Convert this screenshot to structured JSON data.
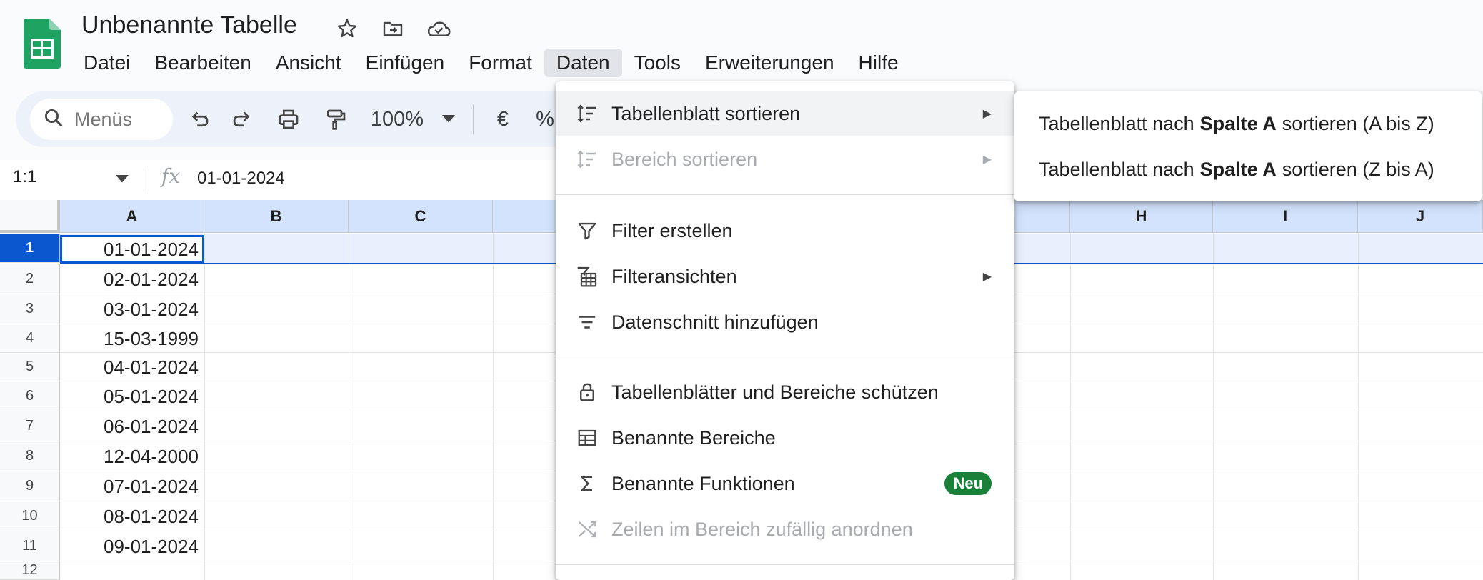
{
  "app": {
    "title": "Unbenannte Tabelle",
    "accent": "#0b57d0",
    "brand": "#188038"
  },
  "menubar": [
    {
      "label": "Datei"
    },
    {
      "label": "Bearbeiten"
    },
    {
      "label": "Ansicht"
    },
    {
      "label": "Einfügen"
    },
    {
      "label": "Format"
    },
    {
      "label": "Daten",
      "active": true
    },
    {
      "label": "Tools"
    },
    {
      "label": "Erweiterungen"
    },
    {
      "label": "Hilfe"
    }
  ],
  "toolbar": {
    "search_placeholder": "Menüs",
    "zoom": "100%",
    "currency": "€",
    "percent": "%"
  },
  "formula_bar": {
    "cell_ref": "1:1",
    "fx": "fx",
    "value": "01-01-2024"
  },
  "grid": {
    "columns": [
      "A",
      "B",
      "C",
      "H",
      "I",
      "J"
    ],
    "rows": [
      "1",
      "2",
      "3",
      "4",
      "5",
      "6",
      "7",
      "8",
      "9",
      "10",
      "11",
      "12"
    ],
    "column_a_values": [
      "01-01-2024",
      "02-01-2024",
      "03-01-2024",
      "15-03-1999",
      "04-01-2024",
      "05-01-2024",
      "06-01-2024",
      "12-04-2000",
      "07-01-2024",
      "08-01-2024",
      "09-01-2024",
      ""
    ]
  },
  "data_menu": {
    "items": [
      {
        "label": "Tabellenblatt sortieren",
        "icon": "sort-icon",
        "submenu": true,
        "highlighted": true
      },
      {
        "label": "Bereich sortieren",
        "icon": "sort-range-icon",
        "submenu": true,
        "disabled": true
      },
      {
        "label": "Filter erstellen",
        "icon": "filter-icon"
      },
      {
        "label": "Filteransichten",
        "icon": "filter-views-icon",
        "submenu": true
      },
      {
        "label": "Datenschnitt hinzufügen",
        "icon": "slicer-icon"
      },
      {
        "label": "Tabellenblätter und Bereiche schützen",
        "icon": "lock-icon"
      },
      {
        "label": "Benannte Bereiche",
        "icon": "named-ranges-icon"
      },
      {
        "label": "Benannte Funktionen",
        "icon": "sigma-icon",
        "badge": "Neu"
      },
      {
        "label": "Zeilen im Bereich zufällig anordnen",
        "icon": "shuffle-icon",
        "disabled": true
      }
    ]
  },
  "sort_submenu": {
    "items": [
      {
        "prefix": "Tabellenblatt nach",
        "bold": "Spalte A",
        "suffix": "sortieren (A bis Z)"
      },
      {
        "prefix": "Tabellenblatt nach",
        "bold": "Spalte A",
        "suffix": "sortieren (Z bis A)"
      }
    ]
  }
}
